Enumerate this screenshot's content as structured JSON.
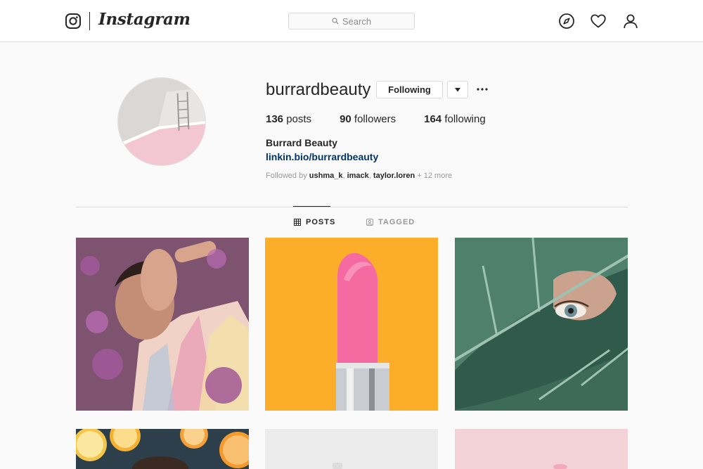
{
  "header": {
    "brand": "Instagram",
    "search_placeholder": "Search",
    "icons": [
      "instagram-glyph-icon",
      "search-icon",
      "compass-icon",
      "heart-icon",
      "person-icon"
    ]
  },
  "profile": {
    "username": "burrardbeauty",
    "follow_button_label": "Following",
    "stats": {
      "posts_count": "136",
      "posts_label": "posts",
      "followers_count": "90",
      "followers_label": "followers",
      "following_count": "164",
      "following_label": "following"
    },
    "full_name": "Burrard Beauty",
    "bio_link": "linkin.bio/burrardbeauty",
    "followed_by": {
      "prefix": "Followed by",
      "users": [
        "ushma_k",
        "imack",
        "taylor.loren"
      ],
      "more": "+ 12 more"
    }
  },
  "tabs": [
    {
      "label": "POSTS",
      "active": true
    },
    {
      "label": "TAGGED",
      "active": false
    }
  ],
  "colors": {
    "link": "#003569",
    "border": "#dbdbdb",
    "text": "#262626",
    "muted": "#999999",
    "background": "#fafafa"
  }
}
